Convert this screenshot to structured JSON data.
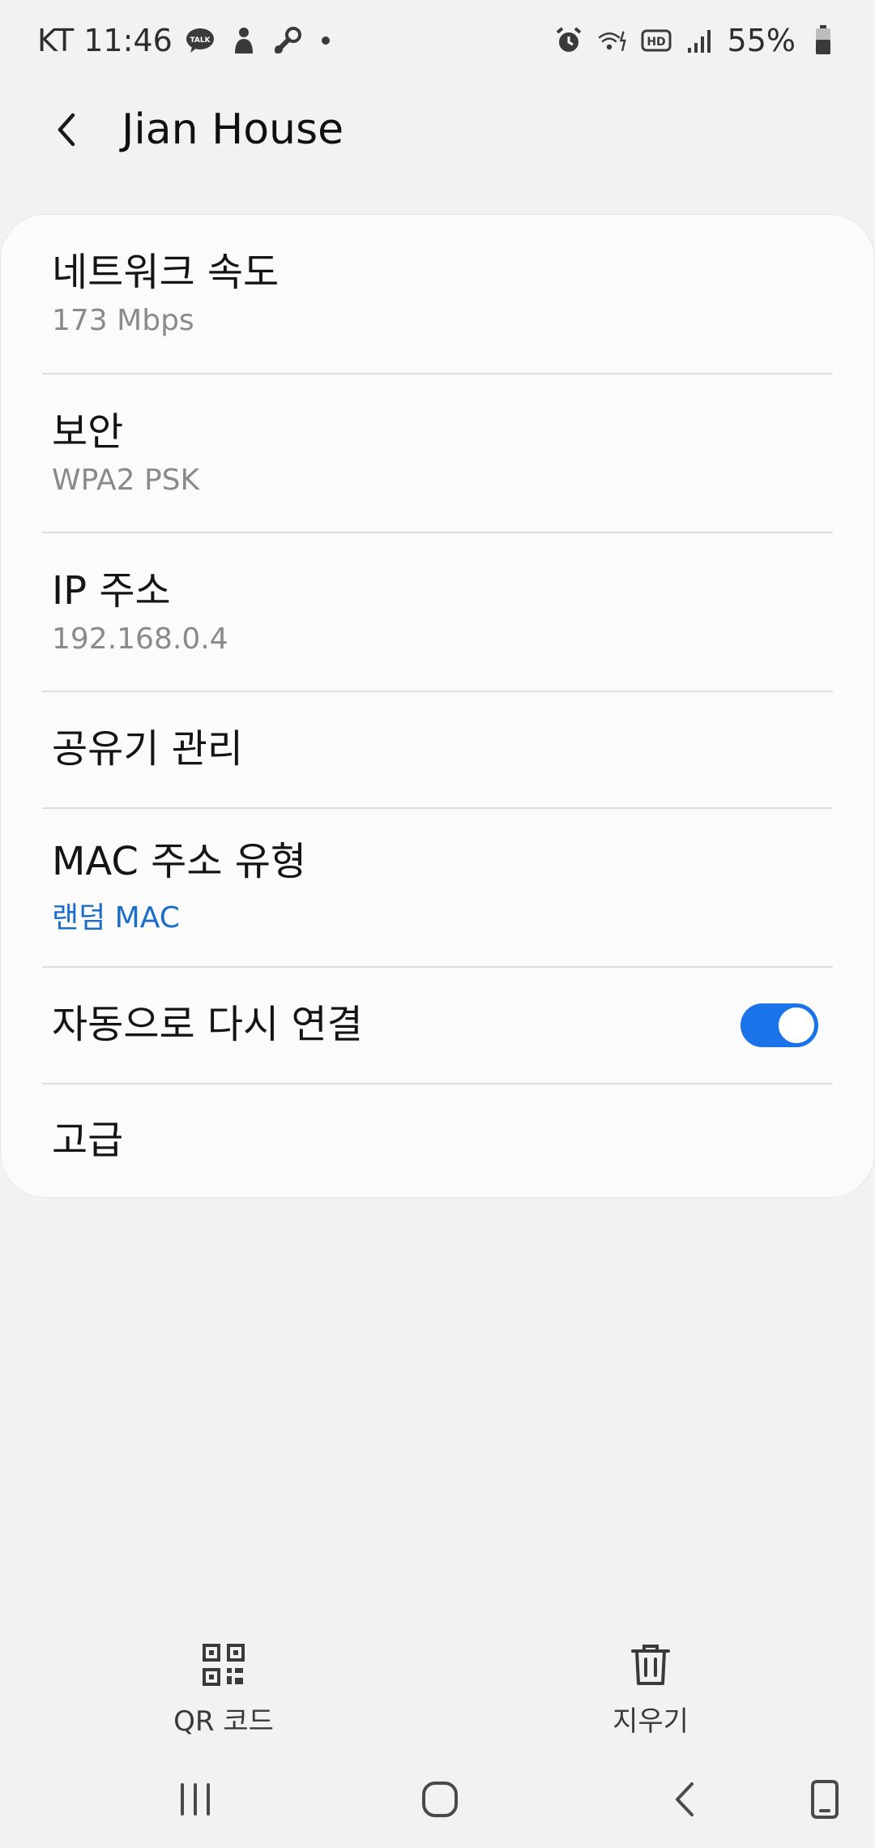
{
  "status_bar": {
    "carrier_time": "KT 11:46",
    "battery_pct": "55%"
  },
  "header": {
    "title": "Jian House"
  },
  "details": {
    "network_speed_label": "네트워크 속도",
    "network_speed_value": "173 Mbps",
    "security_label": "보안",
    "security_value": "WPA2 PSK",
    "ip_label": "IP 주소",
    "ip_value": "192.168.0.4",
    "router_label": "공유기 관리",
    "mac_label": "MAC 주소 유형",
    "mac_value": "랜덤 MAC",
    "auto_reconnect_label": "자동으로 다시 연결",
    "auto_reconnect_on": true,
    "advanced_label": "고급"
  },
  "bottom_actions": {
    "qr_label": "QR 코드",
    "delete_label": "지우기"
  },
  "colors": {
    "accent": "#1a73e8",
    "link_blue": "#1a6cc9",
    "background": "#f2f2f2",
    "card": "#fbfbfb"
  },
  "icons": {
    "back": "chevron-left-icon",
    "qr": "qr-code-icon",
    "delete": "trash-icon",
    "recents": "recent-apps-icon",
    "home": "home-icon",
    "nav_back": "nav-back-icon",
    "keyboard": "rotate-phone-icon"
  }
}
